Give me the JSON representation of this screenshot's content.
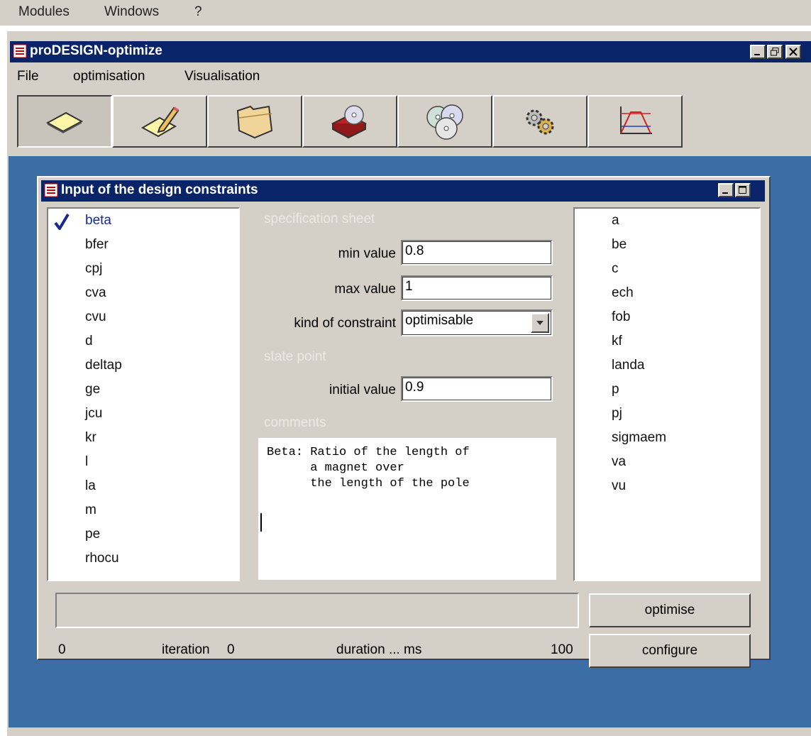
{
  "menubar": {
    "items": [
      "Modules",
      "Windows",
      "?"
    ]
  },
  "app": {
    "title": "proDESIGN-optimize",
    "menu": [
      "File",
      "optimisation",
      "Visualisation"
    ],
    "toolbar": [
      {
        "icon": "new-document-icon"
      },
      {
        "icon": "edit-pencil-icon"
      },
      {
        "icon": "open-folder-icon"
      },
      {
        "icon": "book-cd-icon"
      },
      {
        "icon": "multiple-cds-icon"
      },
      {
        "icon": "gears-icon"
      },
      {
        "icon": "chart-icon"
      }
    ]
  },
  "dialog": {
    "title": "Input of the design constraints",
    "left_list": {
      "selected": "beta",
      "items": [
        "beta",
        "bfer",
        "cpj",
        "cva",
        "cvu",
        "d",
        "deltap",
        "ge",
        "jcu",
        "kr",
        "l",
        "la",
        "m",
        "pe",
        "rhocu"
      ]
    },
    "right_list": {
      "items": [
        "a",
        "be",
        "c",
        "ech",
        "fob",
        "kf",
        "landa",
        "p",
        "pj",
        "sigmaem",
        "va",
        "vu"
      ]
    },
    "spec": {
      "section_label": "specification sheet",
      "min_label": "min value",
      "min_value": "0.8",
      "max_label": "max value",
      "max_value": "1",
      "kind_label": "kind of constraint",
      "kind_value": "optimisable"
    },
    "state": {
      "section_label": "state point",
      "initial_label": "initial value",
      "initial_value": "0.9"
    },
    "comments": {
      "section_label": "comments",
      "text": "Beta: Ratio of the length of\n      a magnet over\n      the length of the pole"
    },
    "status": {
      "progress_min": "0",
      "iteration_label": "iteration",
      "iteration_value": "0",
      "duration_text": "duration ... ms",
      "progress_max": "100",
      "progress_value": 0
    },
    "buttons": {
      "optimise": "optimise",
      "configure": "configure"
    }
  },
  "colors": {
    "titlebar": "#0a246a",
    "desktop": "#3a6ea5",
    "face": "#d4d0c8",
    "selected_text": "#1a2a8a",
    "check": "#1a2a8a"
  }
}
